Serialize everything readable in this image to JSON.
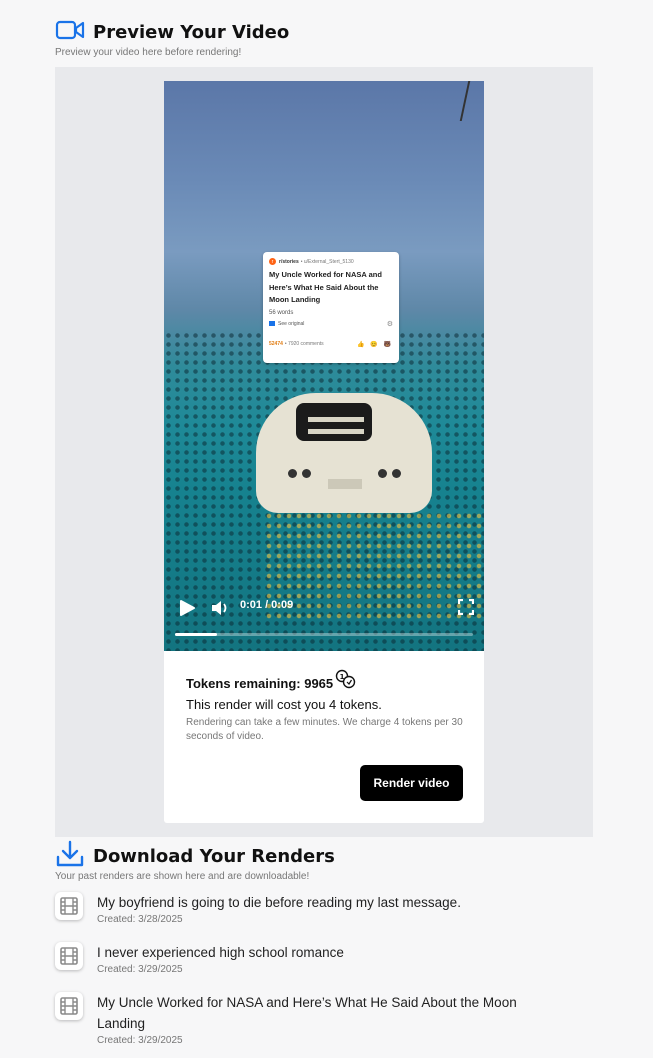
{
  "preview": {
    "title": "Preview Your Video",
    "subtitle": "Preview your video here before rendering!"
  },
  "video": {
    "post": {
      "subreddit": "r/stories",
      "author": "• u/External_Stert_5130",
      "title": "My Uncle Worked for NASA and Here’s What He Said About the Moon Landing",
      "words": "56 words",
      "see_original": "See original",
      "votes": "52474",
      "comments": "• 7920 comments",
      "reactions": "👍 😊 🐻"
    },
    "time": "0:01 / 0:09",
    "progress": 0.14
  },
  "tokens": {
    "label": "Tokens remaining: 9965",
    "cost": "This render will cost you 4 tokens.",
    "note": "Rendering can take a few minutes. We charge 4 tokens per 30 seconds of video."
  },
  "render_button": "Render video",
  "downloads": {
    "title": "Download Your Renders",
    "subtitle": "Your past renders are shown here and are downloadable!",
    "items": [
      {
        "title": "My boyfriend is going to die before reading my last message.",
        "created": "Created: 3/28/2025"
      },
      {
        "title": "I never experienced high school romance",
        "created": "Created: 3/29/2025"
      },
      {
        "title": "My Uncle Worked for NASA and Here’s What He Said About the Moon Landing",
        "created": "Created: 3/29/2025"
      }
    ]
  },
  "colors": {
    "accent": "#1a73e8",
    "button": "#000000"
  }
}
